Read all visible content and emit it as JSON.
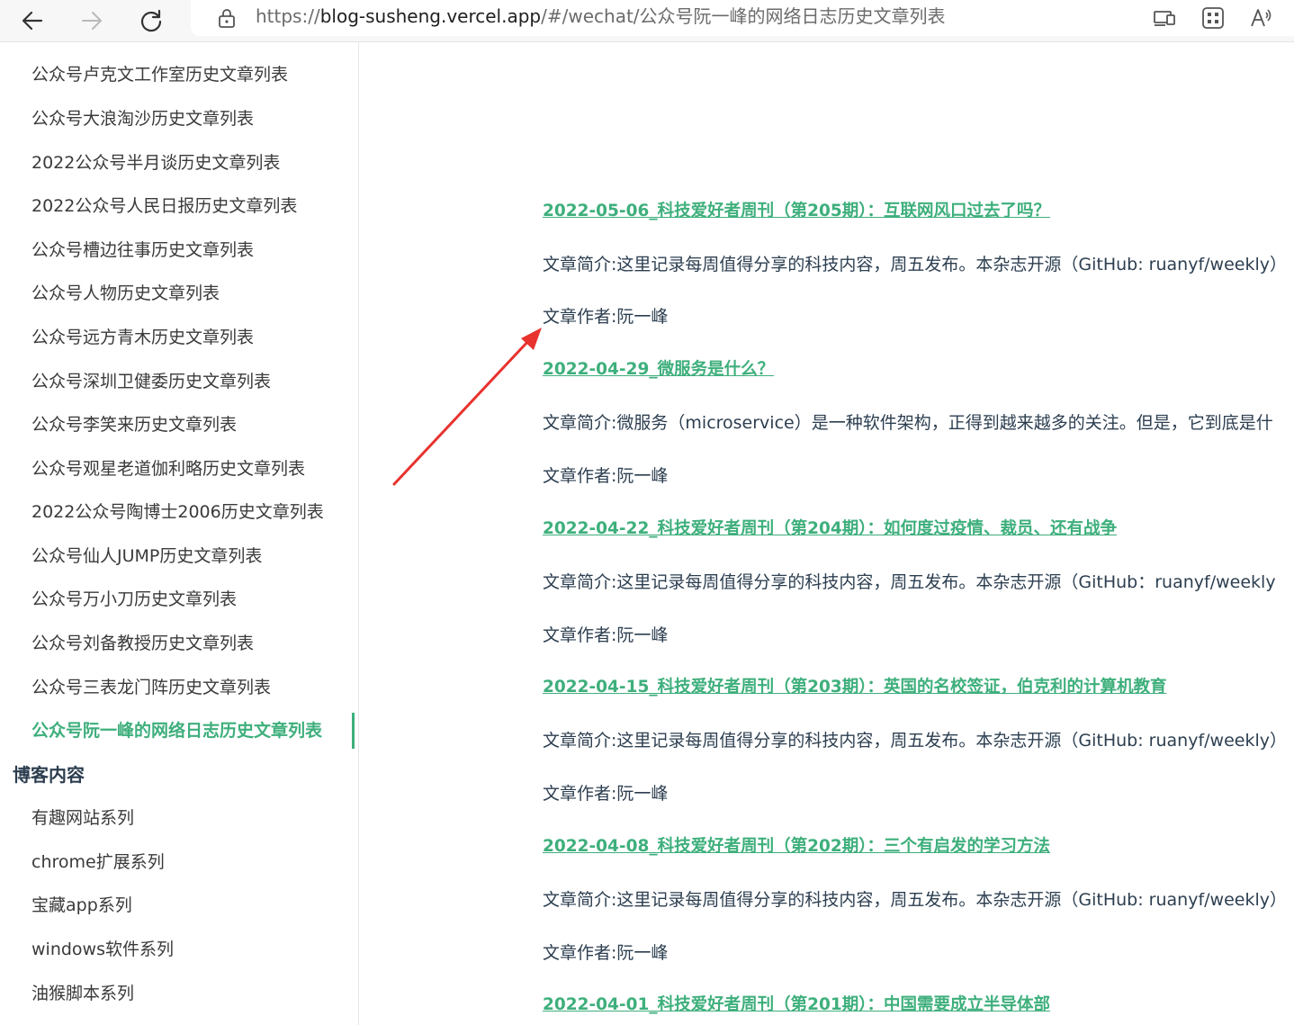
{
  "browser": {
    "url_prefix": "https://",
    "url_host": "blog-susheng.vercel.app",
    "url_path": "/#/wechat/公众号阮一峰的网络日志历史文章列表",
    "icons": [
      "back-arrow-icon",
      "forward-arrow-icon",
      "refresh-icon",
      "lock-icon",
      "device-cast-icon",
      "apps-grid-icon",
      "read-aloud-icon"
    ]
  },
  "sidebar": {
    "items": [
      "公众号卢克文工作室历史文章列表",
      "公众号大浪淘沙历史文章列表",
      "2022公众号半月谈历史文章列表",
      "2022公众号人民日报历史文章列表",
      "公众号槽边往事历史文章列表",
      "公众号人物历史文章列表",
      "公众号远方青木历史文章列表",
      "公众号深圳卫健委历史文章列表",
      "公众号李笑来历史文章列表",
      "公众号观星老道伽利略历史文章列表",
      "2022公众号陶博士2006历史文章列表",
      "公众号仙人JUMP历史文章列表",
      "公众号万小刀历史文章列表",
      "公众号刘备教授历史文章列表",
      "公众号三表龙门阵历史文章列表"
    ],
    "active_item": "公众号阮一峰的网络日志历史文章列表",
    "group_title": "博客内容",
    "group_items": [
      "有趣网站系列",
      "chrome扩展系列",
      "宝藏app系列",
      "windows软件系列",
      "油猴脚本系列"
    ]
  },
  "articles": [
    {
      "title": "2022-05-06_科技爱好者周刊（第205期）：互联网风口过去了吗？",
      "summary": "文章简介:这里记录每周值得分享的科技内容，周五发布。本杂志开源（GitHub: ruanyf/weekly）",
      "author": "文章作者:阮一峰"
    },
    {
      "title": "2022-04-29_微服务是什么？",
      "summary": "文章简介:微服务（microservice）是一种软件架构，正得到越来越多的关注。但是，它到底是什",
      "author": "文章作者:阮一峰"
    },
    {
      "title": "2022-04-22_科技爱好者周刊（第204期）：如何度过疫情、裁员、还有战争",
      "summary": "文章简介:这里记录每周值得分享的科技内容，周五发布。本杂志开源（GitHub：ruanyf/weekly",
      "author": "文章作者:阮一峰"
    },
    {
      "title": "2022-04-15_科技爱好者周刊（第203期）：英国的名校签证，伯克利的计算机教育",
      "summary": "文章简介:这里记录每周值得分享的科技内容，周五发布。本杂志开源（GitHub: ruanyf/weekly）",
      "author": "文章作者:阮一峰"
    },
    {
      "title": "2022-04-08_科技爱好者周刊（第202期）：三个有启发的学习方法",
      "summary": "文章简介:这里记录每周值得分享的科技内容，周五发布。本杂志开源（GitHub: ruanyf/weekly）",
      "author": "文章作者:阮一峰"
    },
    {
      "title": "2022-04-01_科技爱好者周刊（第201期）：中国需要成立半导体部",
      "summary": "",
      "author": ""
    }
  ],
  "colors": {
    "accent": "#3eaf7c",
    "text": "#2c3e50",
    "annotation_arrow": "#e8322e"
  }
}
